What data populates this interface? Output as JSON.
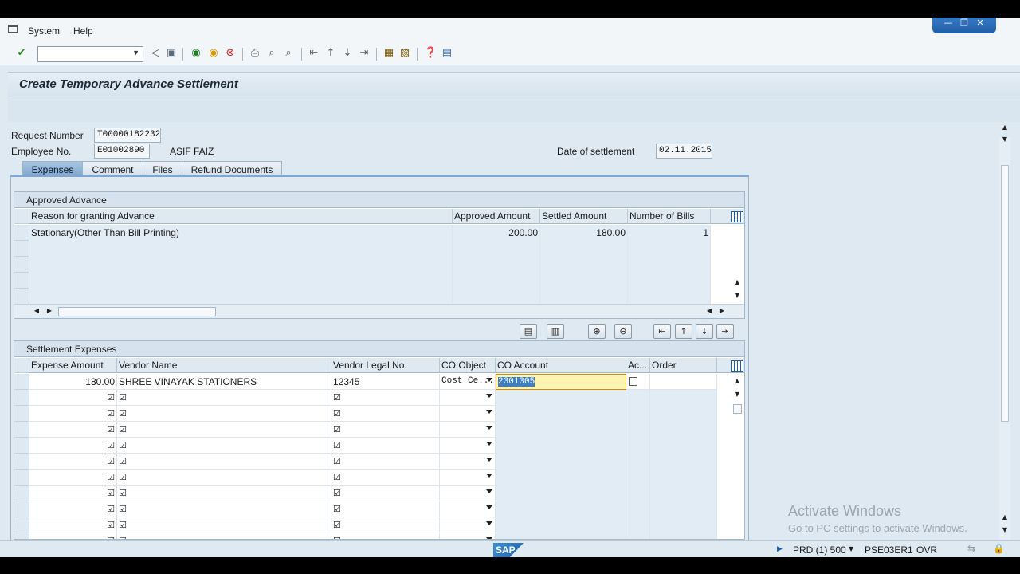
{
  "menu": {
    "items": [
      "System",
      "Help"
    ]
  },
  "window_controls": [
    "—",
    "❐",
    "✕"
  ],
  "toolbar": {
    "command_field_value": "",
    "icons": [
      "check-icon",
      "back-arrow-icon",
      "save-icon",
      "green-back-icon",
      "exit-icon",
      "cancel-icon",
      "print-icon",
      "find-icon",
      "find-next-icon",
      "first-page-icon",
      "prev-page-icon",
      "next-page-icon",
      "last-page-icon",
      "new-session-icon",
      "shortcut-icon",
      "help-icon",
      "layout-icon"
    ]
  },
  "title": "Create Temporary Advance Settlement",
  "form": {
    "request_number_label": "Request Number",
    "request_number_value": "T00000182232",
    "employee_no_label": "Employee No.",
    "employee_no_value": "E01002890",
    "employee_name": "ASIF FAIZ",
    "date_label": "Date of settlement",
    "date_value": "02.11.2015"
  },
  "tabs": [
    {
      "label": "Expenses",
      "active": true
    },
    {
      "label": "Comment",
      "active": false
    },
    {
      "label": "Files",
      "active": false
    },
    {
      "label": "Refund Documents",
      "active": false
    }
  ],
  "approved_advance": {
    "caption": "Approved Advance",
    "columns": [
      "Reason for granting Advance",
      "Approved Amount",
      "Settled Amount",
      "Number of Bills"
    ],
    "rows": [
      {
        "reason": "Stationary(Other Than Bill Printing)",
        "approved": "200.00",
        "settled": "180.00",
        "bills": "1"
      }
    ]
  },
  "settlement_expenses": {
    "caption": "Settlement Expenses",
    "columns": [
      "Expense Amount",
      "Vendor Name",
      "Vendor Legal No.",
      "CO Object",
      "CO Account",
      "Ac...",
      "Order"
    ],
    "rows": [
      {
        "amount": "180.00",
        "vendor": "SHREE VINAYAK STATIONERS",
        "legal_no": "12345",
        "co_object": "Cost Ce...",
        "co_account": "2301305",
        "order": ""
      }
    ],
    "empty_checkbox_glyph": "☑"
  },
  "statusbar": {
    "system": "PRD (1) 500",
    "server": "PSE03ER1",
    "mode": "OVR",
    "logo": "SAP"
  },
  "watermark": {
    "line1": "Activate Windows",
    "line2": "Go to PC settings to activate Windows."
  }
}
